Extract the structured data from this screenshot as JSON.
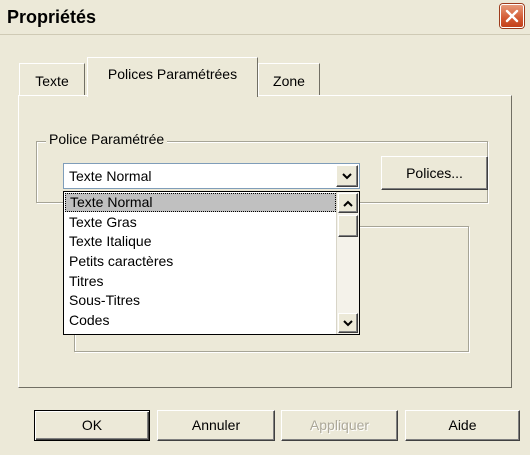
{
  "window": {
    "title": "Propriétés"
  },
  "tabs": [
    {
      "label": "Texte"
    },
    {
      "label": "Polices Paramétrées"
    },
    {
      "label": "Zone"
    }
  ],
  "font_group": {
    "legend": "Police Paramétrée",
    "combo_value": "Texte Normal",
    "fonts_button": "Polices..."
  },
  "dropdown": {
    "items": [
      "Texte Normal",
      "Texte Gras",
      "Texte Italique",
      "Petits caractères",
      "Titres",
      "Sous-Titres",
      "Codes"
    ],
    "selected": "Texte Normal"
  },
  "buttons": {
    "ok": "OK",
    "cancel": "Annuler",
    "apply": "Appliquer",
    "help": "Aide"
  },
  "colors": {
    "dialog_bg": "#ece9d8",
    "close_button": "#d35a33",
    "selection_bg": "#c0c0c0",
    "disabled_text": "#aca899"
  },
  "icons": {
    "close": "close-x-icon",
    "combo_arrow": "chevron-down-icon",
    "scroll_up": "chevron-up-icon",
    "scroll_down": "chevron-down-icon"
  }
}
